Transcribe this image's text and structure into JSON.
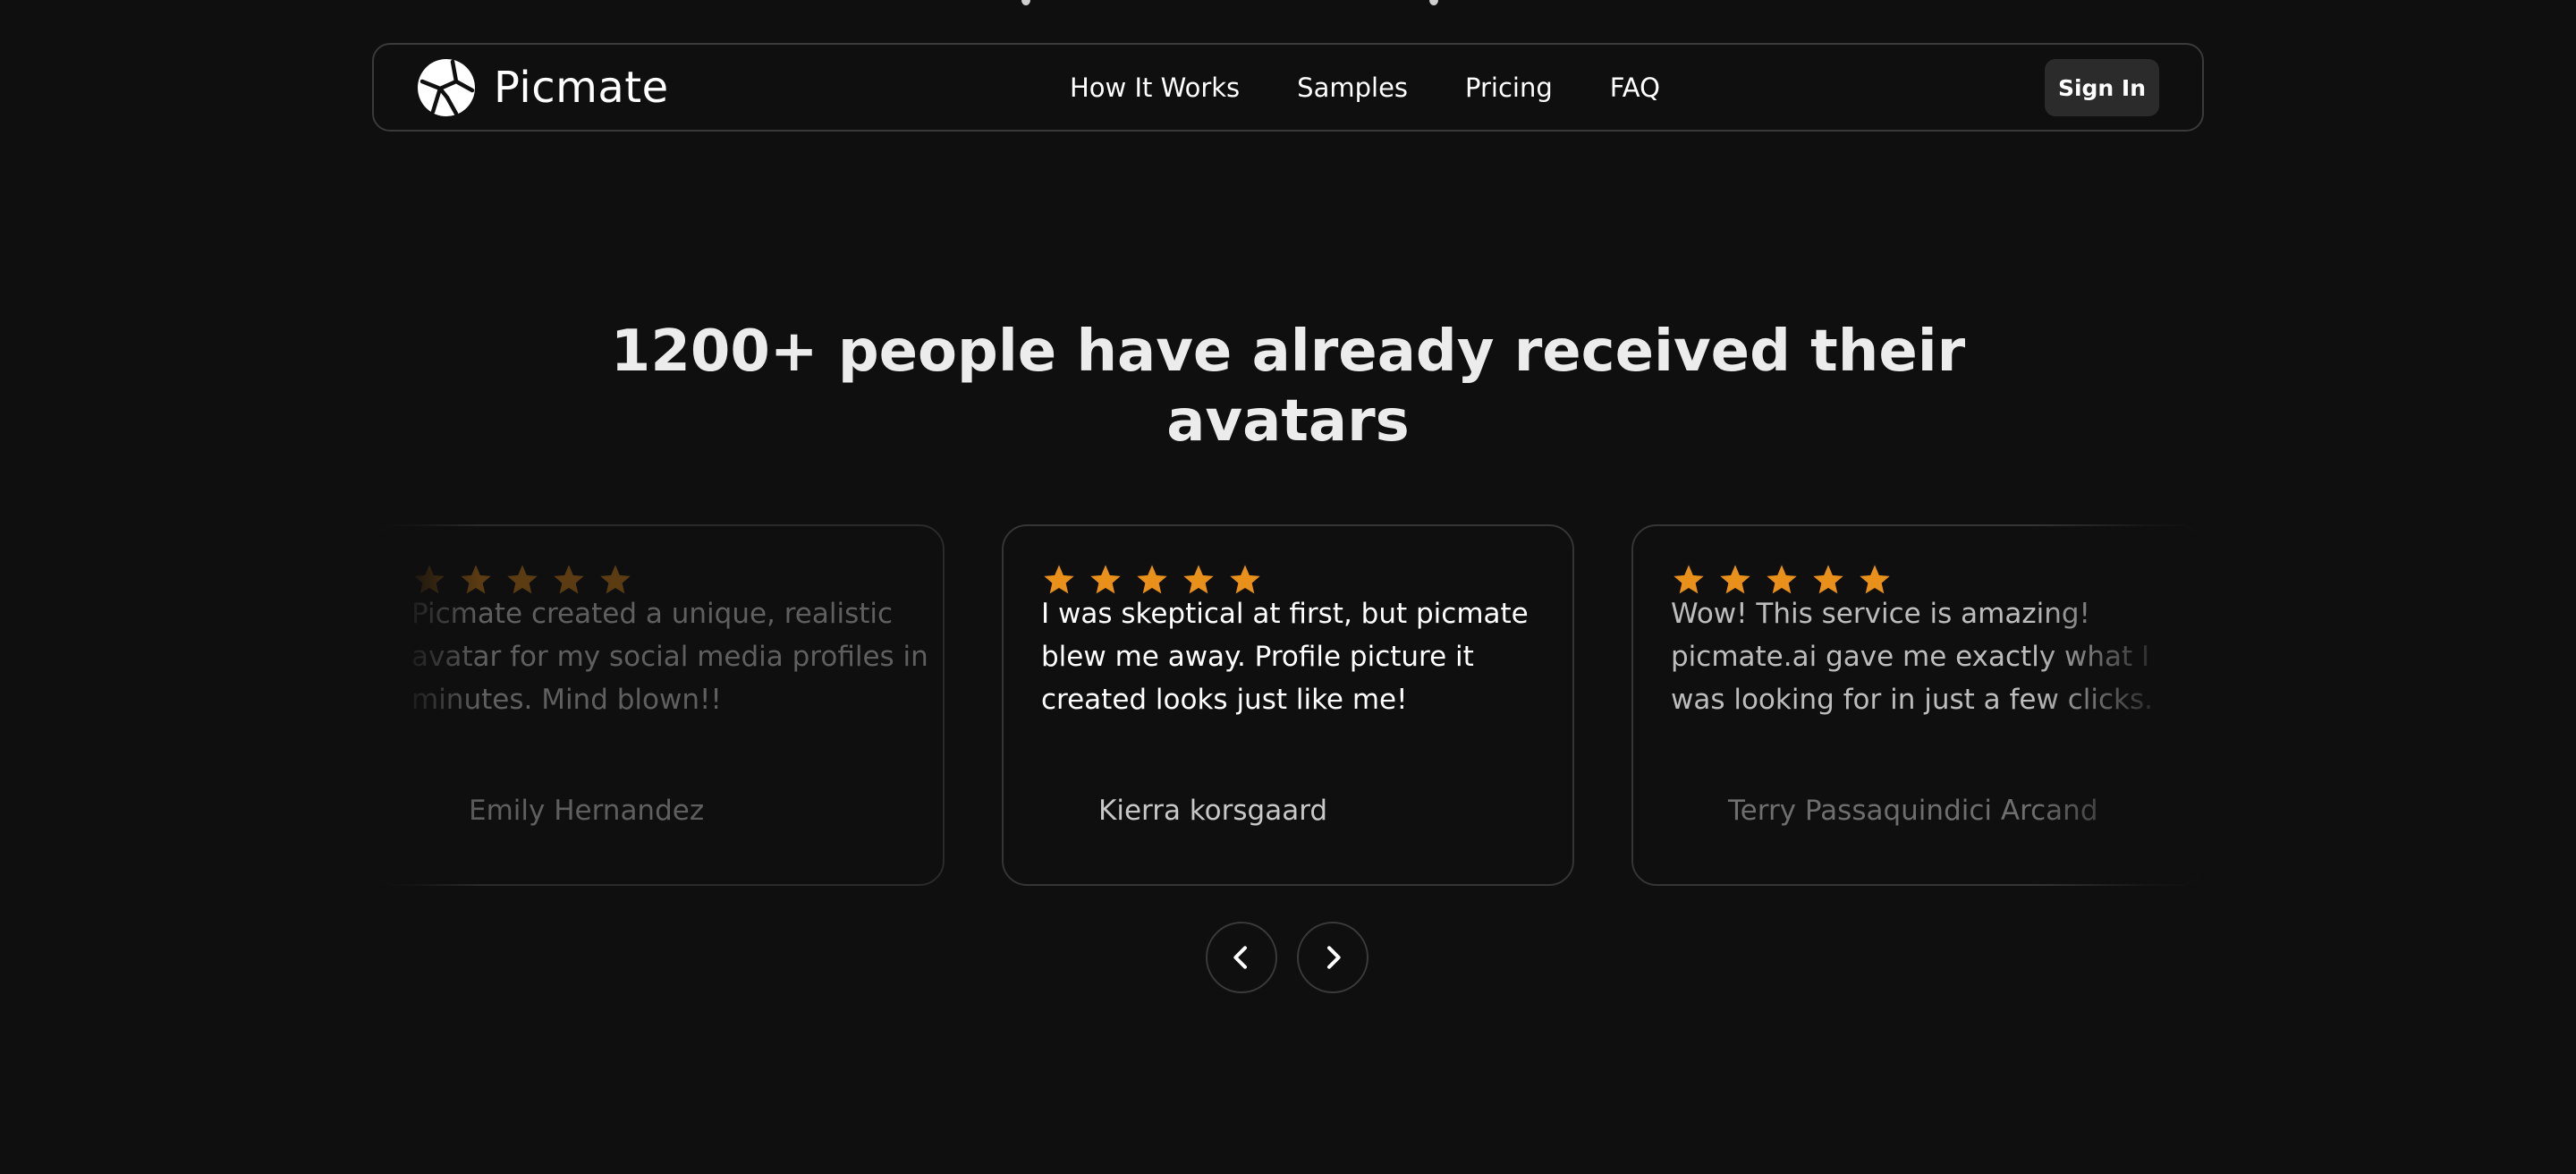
{
  "nav": {
    "brand": "Picmate",
    "links": [
      "How It Works",
      "Samples",
      "Pricing",
      "FAQ"
    ],
    "sign_in": "Sign In"
  },
  "headline": "1200+ people have already received their avatars",
  "testimonials": [
    {
      "rating": 5,
      "quote": "Picmate created a unique, realistic avatar for my social media profiles in minutes. Mind blown!!",
      "author": "Emily Hernandez"
    },
    {
      "rating": 5,
      "quote": "I was skeptical at first, but picmate blew me away. Profile picture it created looks just like me!",
      "author": "Kierra korsgaard"
    },
    {
      "rating": 5,
      "quote": "Wow! This service is amazing! picmate.ai gave me exactly what I was looking for in just a few clicks.",
      "author": "Terry Passaquindici Arcand"
    }
  ],
  "carousel": {
    "prev_icon": "chevron-left-icon",
    "next_icon": "chevron-right-icon"
  },
  "colors": {
    "background": "#0f0f0f",
    "star": "#e8901a",
    "border": "#353535",
    "button": "#2b2b2b"
  }
}
